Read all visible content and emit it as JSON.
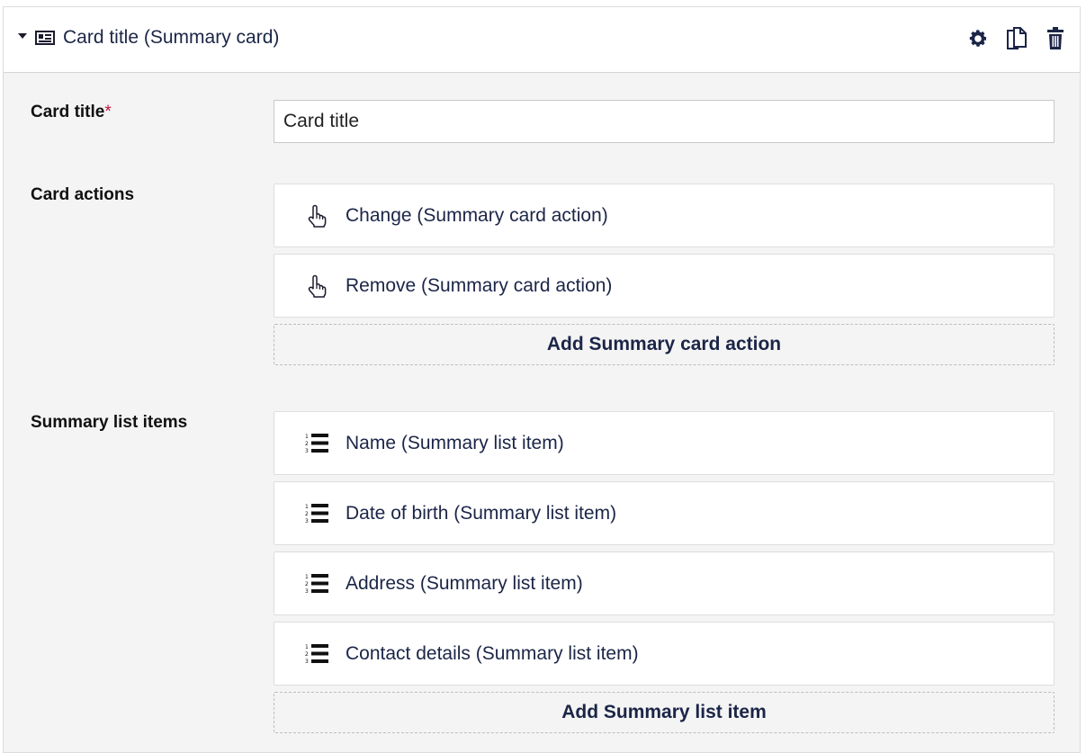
{
  "header": {
    "title": "Card title (Summary card)",
    "toggle_icon": "caret-down-icon",
    "type_icon": "id-card-icon",
    "tools": [
      "gear-icon",
      "copy-icon",
      "trash-icon"
    ]
  },
  "card_title_field": {
    "label": "Card title",
    "required_mark": "*",
    "value": "Card title"
  },
  "card_actions": {
    "label": "Card actions",
    "icon": "pointer-hand-icon",
    "items": [
      {
        "label": "Change (Summary card action)"
      },
      {
        "label": "Remove (Summary card action)"
      }
    ],
    "add_label": "Add Summary card action"
  },
  "summary_list": {
    "label": "Summary list items",
    "icon": "numbered-list-icon",
    "items": [
      {
        "label": "Name (Summary list item)"
      },
      {
        "label": "Date of birth (Summary list item)"
      },
      {
        "label": "Address (Summary list item)"
      },
      {
        "label": "Contact details (Summary list item)"
      }
    ],
    "add_label": "Add Summary list item"
  },
  "colors": {
    "text_primary": "#1b2547",
    "required": "#c0153b",
    "panel_bg": "#f4f4f4"
  }
}
